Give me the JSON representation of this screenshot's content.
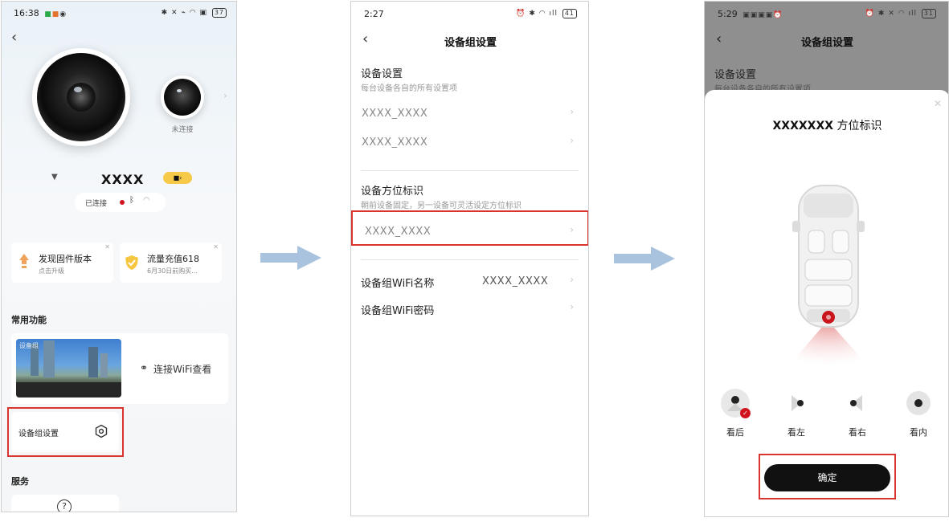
{
  "screen1": {
    "status": {
      "time": "16:38",
      "battery": "37"
    },
    "camera_side_label": "未连接",
    "device_name": "XXXX",
    "connection_status": "已连接",
    "cards": [
      {
        "title": "发现固件版本",
        "subtitle": "点击升级"
      },
      {
        "title": "流量充值618",
        "subtitle": "6月30日前购买..."
      }
    ],
    "section_common": "常用功能",
    "preview_overlay": "设备组",
    "wifi_view_label": "连接WiFi查看",
    "group_settings_label": "设备组设置",
    "section_service": "服务"
  },
  "screen2": {
    "status": {
      "time": "2:27",
      "battery": "41"
    },
    "title": "设备组设置",
    "device_settings": {
      "title": "设备设置",
      "subtitle": "每台设备各自的所有设置项",
      "items": [
        "XXXX_XXXX",
        "XXXX_XXXX"
      ]
    },
    "orientation": {
      "title": "设备方位标识",
      "subtitle": "朝前设备固定，另一设备可灵活设定方位标识",
      "item": "XXXX_XXXX"
    },
    "wifi_name": {
      "label": "设备组WiFi名称",
      "value": "XXXX_XXXX"
    },
    "wifi_password": {
      "label": "设备组WiFi密码"
    }
  },
  "screen3": {
    "status": {
      "time": "5:29",
      "battery": "31"
    },
    "title": "设备组设置",
    "bg_section_title": "设备设置",
    "bg_section_sub": "每台设备各自的所有设置项",
    "sheet_title_device": "XXXXXXX",
    "sheet_title_suffix": "方位标识",
    "options": [
      "看后",
      "看左",
      "看右",
      "看内"
    ],
    "selected_option": "看后",
    "confirm": "确定"
  },
  "colors": {
    "highlight": "#d9342e",
    "arrow": "#a9c3de",
    "accent_red": "#d0141c",
    "dark_button": "#111111"
  }
}
